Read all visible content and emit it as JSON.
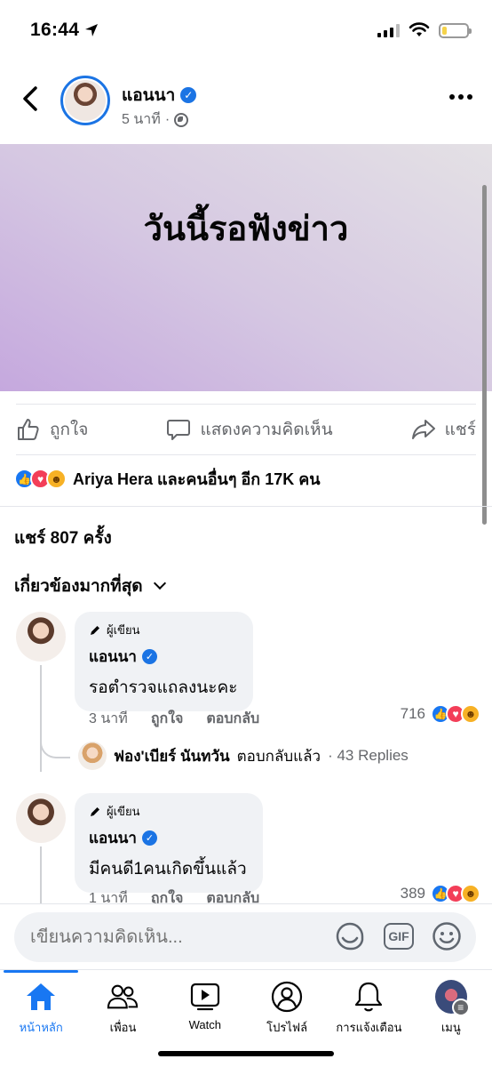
{
  "status_bar": {
    "time": "16:44"
  },
  "header": {
    "author": "แอนนา",
    "time_ago": "5 นาที",
    "separator": "·"
  },
  "post": {
    "text": "วันนี้รอฟังข่าว",
    "background_colors": [
      "#c5a8de",
      "#e4e1e5"
    ]
  },
  "actions": {
    "like": "ถูกใจ",
    "comment": "แสดงความคิดเห็น",
    "share": "แชร์"
  },
  "reactions_summary": "Ariya Hera และคนอื่นๆ อีก 17K คน",
  "share_count": "แชร์ 807 ครั้ง",
  "filter_label": "เกี่ยวข้องมากที่สุด",
  "comments": [
    {
      "author_tag": "ผู้เขียน",
      "name": "แอนนา",
      "text": "รอตำรวจแถลงนะคะ",
      "time": "3 นาที",
      "like_label": "ถูกใจ",
      "reply_label": "ตอบกลับ",
      "reaction_count": "716",
      "reply": {
        "name": "ฟอง'เบียร์ นันทวัน",
        "action": "ตอบกลับแล้ว",
        "count": "· 43 Replies"
      }
    },
    {
      "author_tag": "ผู้เขียน",
      "name": "แอนนา",
      "text": "มีคนดี1คนเกิดขึ้นแล้ว",
      "time": "1 นาที",
      "like_label": "ถูกใจ",
      "reply_label": "ตอบกลับ",
      "reaction_count": "389"
    }
  ],
  "comment_input": {
    "placeholder": "เขียนความคิดเห็น..."
  },
  "input_icons": {
    "gif": "GIF"
  },
  "bottom_nav": [
    {
      "label": "หน้าหลัก",
      "icon": "home-icon"
    },
    {
      "label": "เพื่อน",
      "icon": "friends-icon"
    },
    {
      "label": "Watch",
      "icon": "watch-icon"
    },
    {
      "label": "โปรไฟล์",
      "icon": "profile-icon"
    },
    {
      "label": "การแจ้งเตือน",
      "icon": "bell-icon"
    },
    {
      "label": "เมนู",
      "icon": "menu-avatar-icon"
    }
  ],
  "colors": {
    "accent": "#1877f2",
    "verified": "#1b74e4",
    "bubble": "#f0f2f5"
  }
}
